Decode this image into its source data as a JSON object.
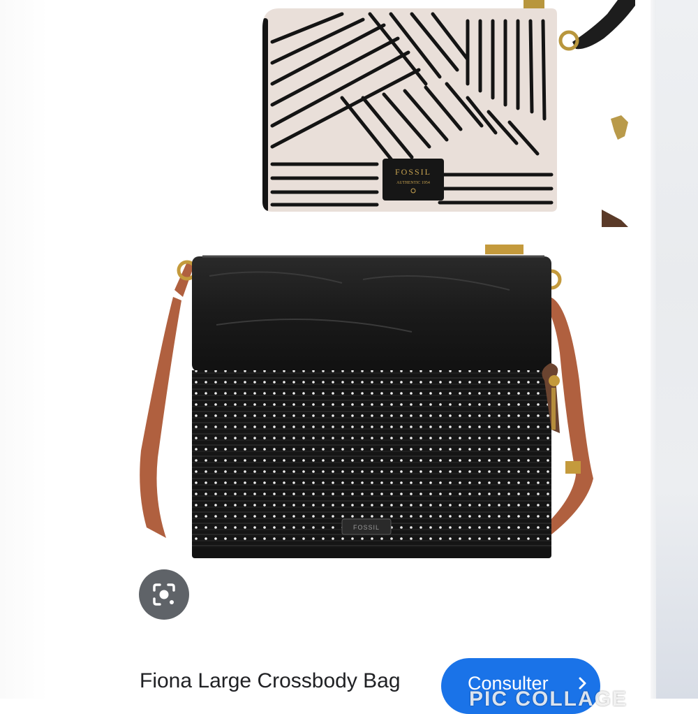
{
  "wristlet": {
    "brand": "FOSSIL",
    "brand_sub": "AUTHENTIC 1954"
  },
  "crossbody": {
    "tag_text": "FOSSIL"
  },
  "lens": {
    "icon": "lens-icon"
  },
  "result": {
    "title": "Fiona Large Crossbody Bag",
    "button_label": "Consulter",
    "button_icon": "chevron-right-icon"
  },
  "watermark": {
    "text": "PIC COLLAGE"
  },
  "colors": {
    "button_blue": "#1a73e8",
    "lens_grey": "#5f6368",
    "title_text": "#202124",
    "strap_brown": "#b0603f"
  }
}
